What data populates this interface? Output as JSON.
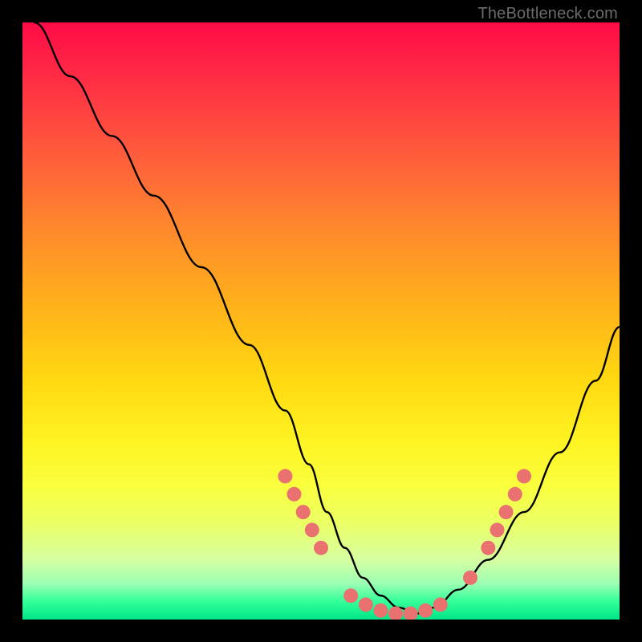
{
  "watermark": "TheBottleneck.com",
  "chart_data": {
    "type": "line",
    "title": "",
    "xlabel": "",
    "ylabel": "",
    "xlim": [
      0,
      100
    ],
    "ylim": [
      0,
      100
    ],
    "series": [
      {
        "name": "bottleneck-curve",
        "x": [
          2,
          8,
          15,
          22,
          30,
          38,
          44,
          48,
          51,
          54,
          57,
          60,
          63,
          66,
          69,
          73,
          78,
          84,
          90,
          96,
          100
        ],
        "y": [
          100,
          91,
          81,
          71,
          59,
          46,
          35,
          26,
          18,
          12,
          7,
          4,
          2,
          1,
          2,
          5,
          10,
          18,
          28,
          40,
          49
        ]
      }
    ],
    "markers": [
      {
        "name": "curve-dots",
        "color": "#e9716f",
        "points": [
          {
            "x": 44.0,
            "y": 24.0
          },
          {
            "x": 45.5,
            "y": 21.0
          },
          {
            "x": 47.0,
            "y": 18.0
          },
          {
            "x": 48.5,
            "y": 15.0
          },
          {
            "x": 50.0,
            "y": 12.0
          },
          {
            "x": 55.0,
            "y": 4.0
          },
          {
            "x": 57.5,
            "y": 2.5
          },
          {
            "x": 60.0,
            "y": 1.5
          },
          {
            "x": 62.5,
            "y": 1.0
          },
          {
            "x": 65.0,
            "y": 1.0
          },
          {
            "x": 67.5,
            "y": 1.5
          },
          {
            "x": 70.0,
            "y": 2.5
          },
          {
            "x": 75.0,
            "y": 7.0
          },
          {
            "x": 78.0,
            "y": 12.0
          },
          {
            "x": 79.5,
            "y": 15.0
          },
          {
            "x": 81.0,
            "y": 18.0
          },
          {
            "x": 82.5,
            "y": 21.0
          },
          {
            "x": 84.0,
            "y": 24.0
          }
        ]
      }
    ]
  }
}
